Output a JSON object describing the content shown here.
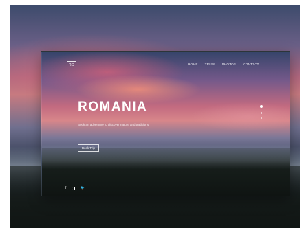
{
  "hero": {
    "title": "ROMANIA",
    "description": "Book an adventure to discover nature and traditions.",
    "cta_label": "Book Trip"
  },
  "brand": {
    "logo_text": "RO"
  },
  "nav": {
    "items": [
      {
        "label": "HOME",
        "active": true
      },
      {
        "label": "TRIPS",
        "active": false
      },
      {
        "label": "PHOTOS",
        "active": false
      },
      {
        "label": "CONTACT",
        "active": false
      }
    ]
  },
  "social": {
    "icons": [
      "facebook-icon",
      "instagram-icon",
      "twitter-icon"
    ],
    "glyphs": {
      "facebook": "f",
      "twitter": "🐦"
    }
  },
  "colors": {
    "accent": "#ffffff",
    "sky_pink": "#c26a80",
    "sky_blue": "#35446a",
    "forest": "#101513"
  }
}
